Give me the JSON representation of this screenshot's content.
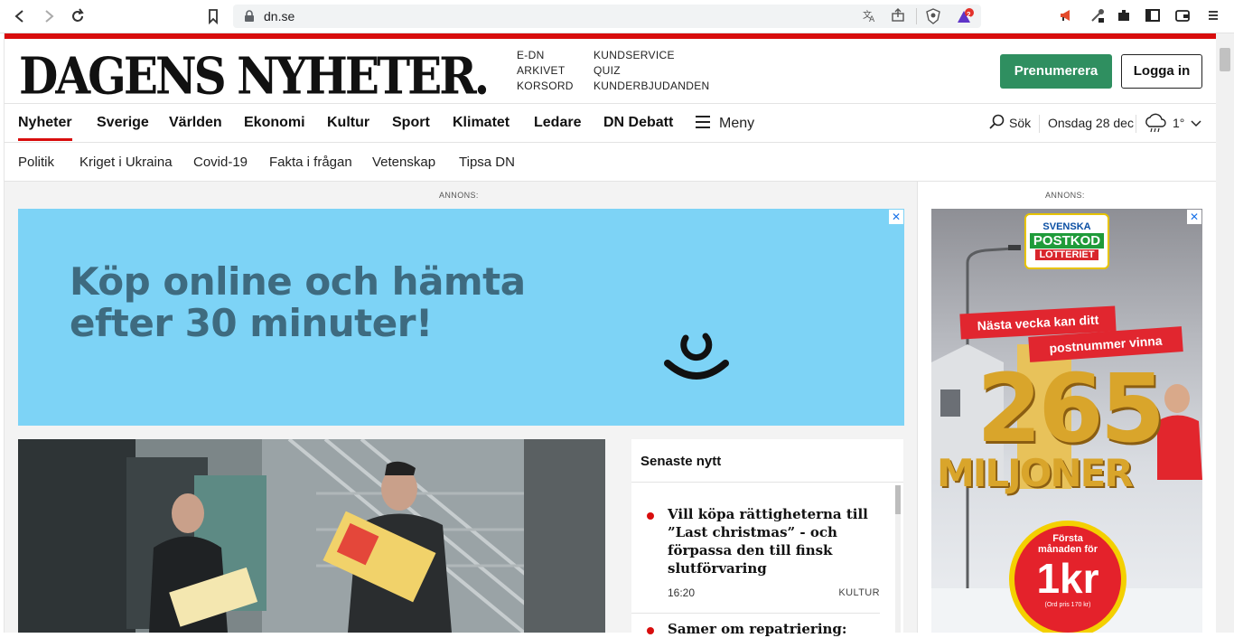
{
  "browser": {
    "url": "dn.se",
    "brave_badge": "2"
  },
  "masthead": {
    "logo": "DAGENS NYHETER.",
    "quick_links_left": [
      "E-DN",
      "ARKIVET",
      "KORSORD"
    ],
    "quick_links_right": [
      "KUNDSERVICE",
      "QUIZ",
      "KUNDERBJUDANDEN"
    ],
    "subscribe_label": "Prenumerera",
    "login_label": "Logga in"
  },
  "mainnav": {
    "items": [
      "Nyheter",
      "Sverige",
      "Världen",
      "Ekonomi",
      "Kultur",
      "Sport",
      "Klimatet",
      "Ledare",
      "DN Debatt"
    ],
    "menu_label": "Meny",
    "search_label": "Sök",
    "date": "Onsdag 28 dec",
    "temperature": "1°",
    "active": "Nyheter"
  },
  "subnav": {
    "items": [
      "Politik",
      "Kriget i Ukraina",
      "Covid-19",
      "Fakta i frågan",
      "Vetenskap",
      "Tipsa DN"
    ]
  },
  "ads": {
    "label": "ANNONS:",
    "main_line1": "Köp online och hämta",
    "main_line2": "efter 30 minuter!",
    "side_brand": [
      "SVENSKA",
      "POSTKOD",
      "LOTTERIET"
    ],
    "side_ribbon1": "Nästa vecka kan ditt",
    "side_ribbon2": "postnummer vinna",
    "side_amount": "265",
    "side_unit": "MILJONER",
    "side_badge_top": "Första",
    "side_badge_mid": "månaden för",
    "side_badge_price": "1kr",
    "side_badge_note": "(Ord pris 170 kr)"
  },
  "latest": {
    "title": "Senaste nytt",
    "items": [
      {
        "title": "Vill köpa rättigheterna till ”Last christmas” - och förpassa den till finsk slutförvaring",
        "time": "16:20",
        "category": "KULTUR"
      },
      {
        "title": "Samer om repatriering:",
        "time": "",
        "category": ""
      }
    ]
  },
  "colors": {
    "brand_red": "#d80d0d",
    "subscribe_green": "#2f8f60",
    "ad_blue": "#7dd3f6"
  }
}
